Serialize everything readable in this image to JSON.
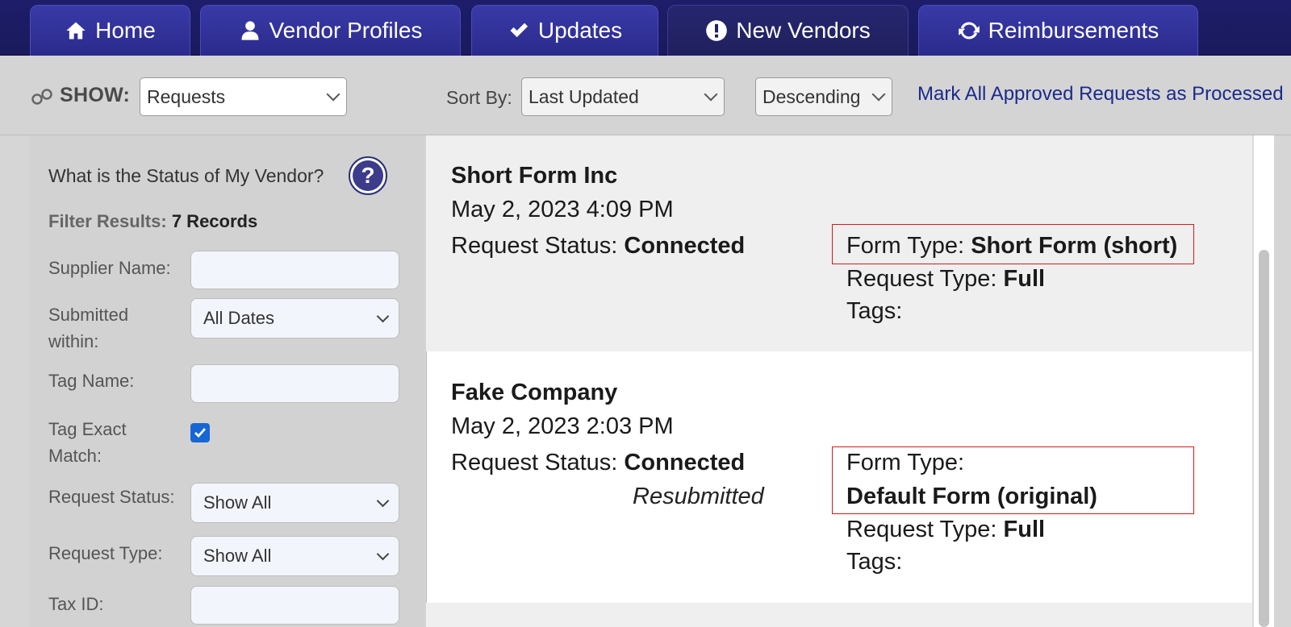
{
  "nav": {
    "tabs": [
      {
        "label": "Home",
        "icon": "home-icon"
      },
      {
        "label": "Vendor Profiles",
        "icon": "user-icon"
      },
      {
        "label": "Updates",
        "icon": "check-icon"
      },
      {
        "label": "New Vendors",
        "icon": "exclamation-icon"
      },
      {
        "label": "Reimbursements",
        "icon": "refresh-icon"
      }
    ]
  },
  "toolbar": {
    "show_label": "SHOW:",
    "show_value": "Requests",
    "sort_label": "Sort By:",
    "sort_value": "Last Updated",
    "order_value": "Descending",
    "mark_link": "Mark All Approved Requests as Processed"
  },
  "sidebar": {
    "status_question": "What is the Status of My Vendor?",
    "filter_results_label": "Filter Results:",
    "filter_results_count": "7 Records",
    "supplier_name_label": "Supplier Name:",
    "supplier_name_value": "",
    "submitted_within_label_1": "Submitted",
    "submitted_within_label_2": "within:",
    "submitted_within_value": "All Dates",
    "tag_name_label": "Tag Name:",
    "tag_name_value": "",
    "tag_exact_label_1": "Tag Exact",
    "tag_exact_label_2": "Match:",
    "tag_exact_checked": true,
    "request_status_label": "Request Status:",
    "request_status_value": "Show All",
    "request_type_label": "Request Type:",
    "request_type_value": "Show All",
    "tax_id_label": "Tax ID:",
    "tax_id_value": ""
  },
  "records": [
    {
      "name": "Short Form Inc",
      "date": "May 2, 2023 4:09 PM",
      "status_label": "Request Status:",
      "status_value": "Connected",
      "form_type_label": "Form Type:",
      "form_type_value": "Short Form (short)",
      "request_type_label": "Request Type:",
      "request_type_value": "Full",
      "tags_label": "Tags:"
    },
    {
      "name": "Fake Company",
      "date": "May 2, 2023 2:03 PM",
      "status_label": "Request Status:",
      "status_value": "Connected",
      "status_note": "Resubmitted",
      "form_type_label": "Form Type:",
      "form_type_value": "Default Form (original)",
      "request_type_label": "Request Type:",
      "request_type_value": "Full",
      "tags_label": "Tags:"
    }
  ],
  "colors": {
    "nav_bg": "#1a1a5c",
    "tab_bg": "#2a2a8c",
    "link": "#1a2a8c",
    "highlight_box": "#d61a1a",
    "checkbox": "#1766d6"
  }
}
